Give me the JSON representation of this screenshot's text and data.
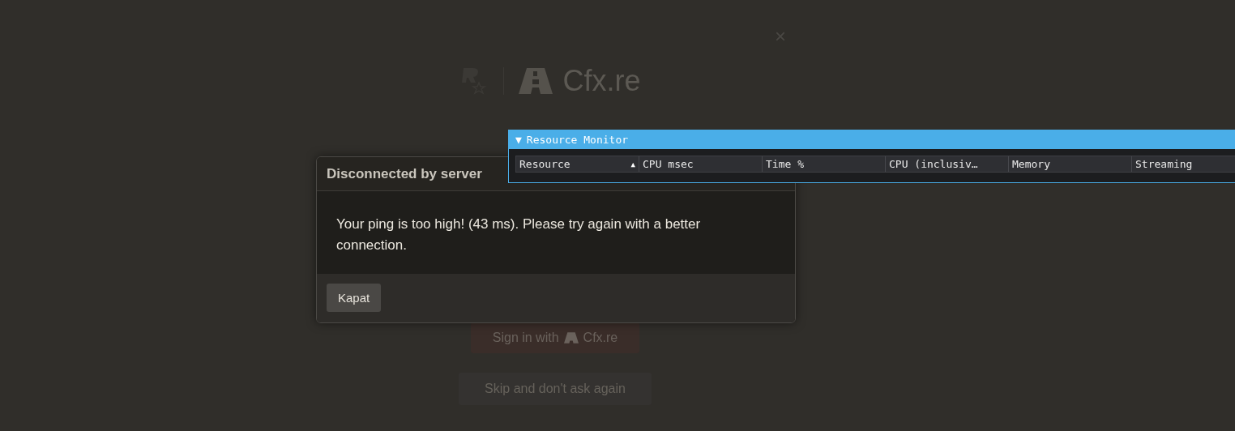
{
  "background": {
    "close_glyph": "×",
    "logo_text": "Cfx.re",
    "sign_in_button": {
      "prefix": "Sign in with",
      "brand": "Cfx.re"
    },
    "skip_button": "Skip and don't ask again"
  },
  "dialog": {
    "title": "Disconnected by server",
    "message": "Your ping is too high! (43 ms). Please try again with a better connection.",
    "buttons": [
      "Kapat"
    ]
  },
  "resource_monitor": {
    "toggle": "▼",
    "title": "Resource Monitor",
    "expanded": true,
    "columns": [
      {
        "label": "Resource",
        "sort_indicator": "▲"
      },
      {
        "label": "CPU msec"
      },
      {
        "label": "Time %"
      },
      {
        "label": "CPU (inclusiv…"
      },
      {
        "label": "Memory"
      },
      {
        "label": "Streaming"
      }
    ]
  }
}
